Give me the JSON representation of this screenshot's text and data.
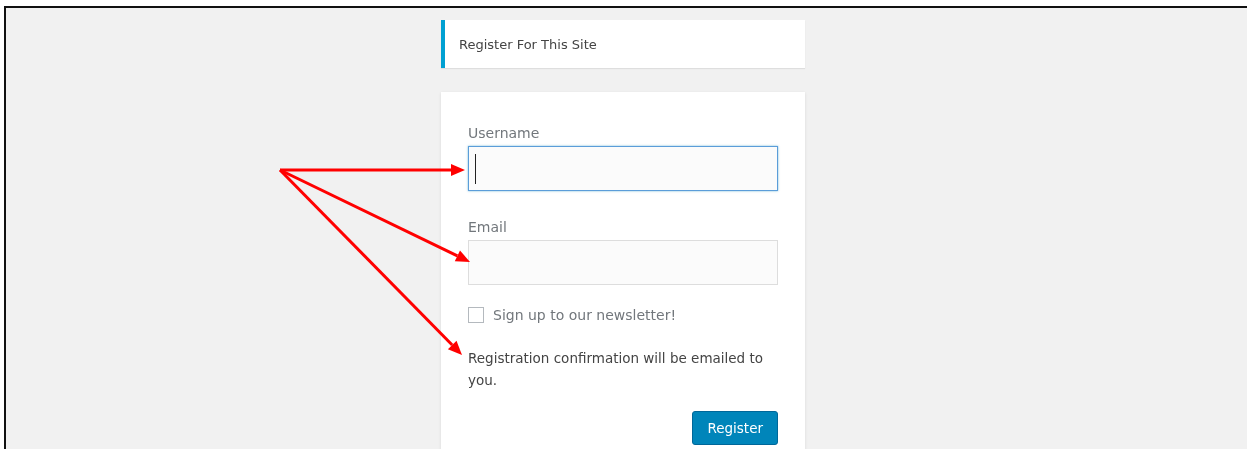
{
  "header": {
    "title": "Register For This Site"
  },
  "form": {
    "fields": [
      {
        "label": "Username",
        "focused": true
      },
      {
        "label": "Email",
        "focused": false
      }
    ],
    "newsletter": {
      "label": "Sign up to our newsletter!",
      "checked": false
    },
    "message": "Registration confirmation will be emailed to you.",
    "submit": "Register"
  }
}
